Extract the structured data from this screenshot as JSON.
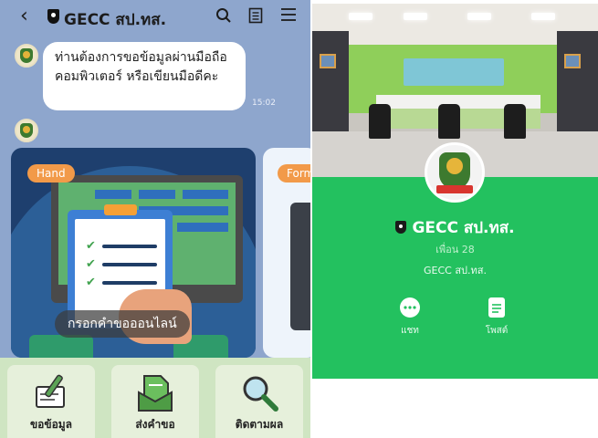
{
  "chat": {
    "header": {
      "back_icon": "chevron-left-icon",
      "title": "GECC สป.ทส.",
      "icons": [
        "search-icon",
        "notes-icon",
        "menu-icon"
      ]
    },
    "message": {
      "text": "ท่านต้องการขอข้อมูลผ่านมือถือ คอมพิวเตอร์ หรือเขียนมือดีคะ",
      "time": "15:02"
    },
    "cards": [
      {
        "tag": "Hand",
        "label": "กรอกคำขอออนไลน์"
      },
      {
        "tag": "Form"
      }
    ],
    "rich_menu": [
      {
        "label": "ขอข้อมูล",
        "icon": "form-writing-icon"
      },
      {
        "label": "ส่งคำขอ",
        "icon": "send-document-icon"
      },
      {
        "label": "ติดตามผล",
        "icon": "magnifier-icon"
      }
    ]
  },
  "profile": {
    "name": "GECC สป.ทส.",
    "friends": "เพื่อน 28",
    "status": "GECC สป.ทส.",
    "actions": [
      {
        "label": "แชท",
        "icon": "chat-icon"
      },
      {
        "label": "โพสต์",
        "icon": "post-icon"
      }
    ]
  },
  "colors": {
    "chat_bg": "#8ea6cd",
    "profile_green": "#23c15f",
    "tag_orange": "#f29a49",
    "menu_green": "#cfe5c2"
  }
}
